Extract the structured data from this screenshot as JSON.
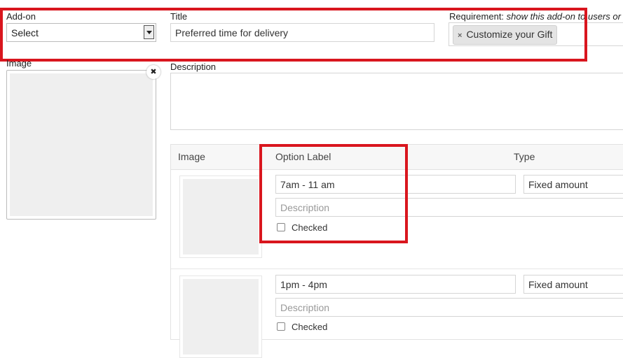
{
  "addon": {
    "label": "Add-on",
    "select_value": "Select"
  },
  "title_field": {
    "label": "Title",
    "value": "Preferred time for delivery"
  },
  "requirement": {
    "label": "Requirement: ",
    "hint": "show this add-on to users or",
    "tag_label": "Customize your Gift",
    "tag_remove": "×"
  },
  "image_panel": {
    "label": "Image",
    "remove": "✖"
  },
  "description": {
    "label": "Description"
  },
  "options_table": {
    "headers": {
      "image": "Image",
      "option_label": "Option Label",
      "type": "Type"
    },
    "rows": [
      {
        "label": "7am - 11 am",
        "description_placeholder": "Description",
        "type": "Fixed amount",
        "checked_label": "Checked"
      },
      {
        "label": "1pm - 4pm",
        "description_placeholder": "Description",
        "type": "Fixed amount",
        "checked_label": "Checked"
      }
    ]
  },
  "highlight_color": "#d9161e"
}
